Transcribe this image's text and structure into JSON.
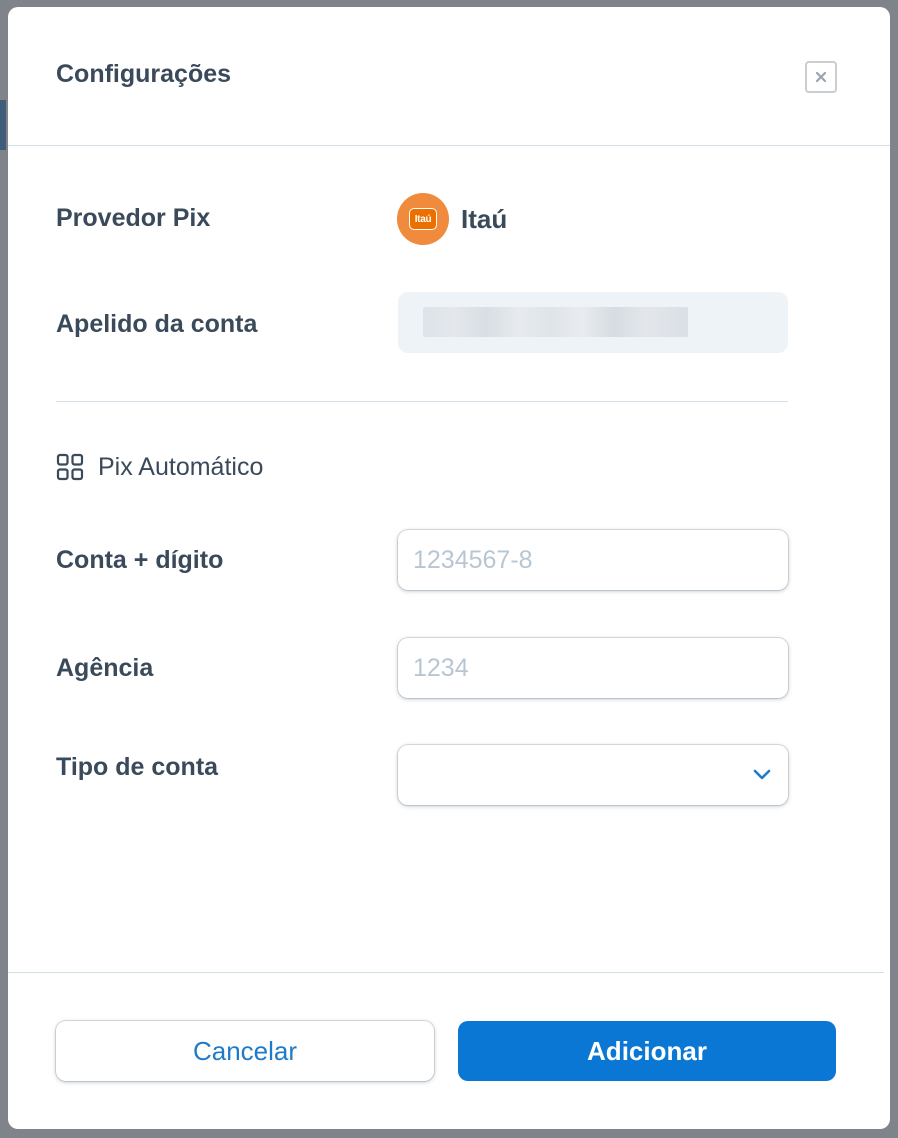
{
  "dialog": {
    "title": "Configurações"
  },
  "provider": {
    "label": "Provedor Pix",
    "logo_text": "Itaú",
    "name": "Itaú"
  },
  "nickname": {
    "label": "Apelido da conta"
  },
  "section": {
    "title": "Pix Automático"
  },
  "fields": {
    "account": {
      "label": "Conta + dígito",
      "placeholder": "1234567-8"
    },
    "agency": {
      "label": "Agência",
      "placeholder": "1234"
    },
    "account_type": {
      "label": "Tipo de conta",
      "value": ""
    }
  },
  "actions": {
    "cancel_label": "Cancelar",
    "submit_label": "Adicionar"
  },
  "colors": {
    "primary": "#0977d3",
    "text": "#3a4a5a",
    "provider_brand": "#ec7000"
  }
}
